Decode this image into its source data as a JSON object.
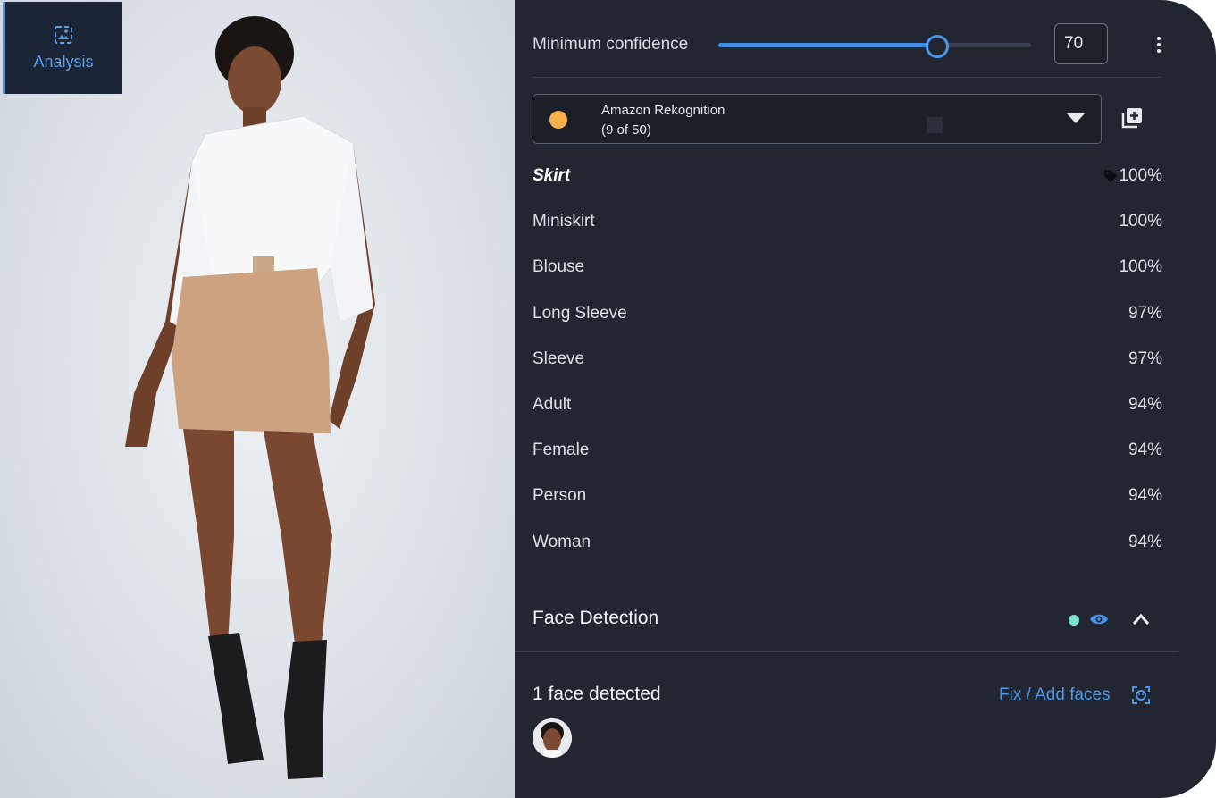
{
  "sidebar": {
    "analysis_tab_label": "Analysis",
    "analysis_tab_icon": "image-analysis-icon"
  },
  "confidence": {
    "label": "Minimum confidence",
    "value": "70",
    "slider_fraction": 0.7
  },
  "engine": {
    "name": "Amazon Rekognition",
    "count": "(9 of 50)",
    "dot_color": "#f7b04a"
  },
  "labels": [
    {
      "name": "Skirt",
      "value": "100%"
    },
    {
      "name": "Miniskirt",
      "value": "100%"
    },
    {
      "name": "Blouse",
      "value": "100%"
    },
    {
      "name": "Long Sleeve",
      "value": "97%"
    },
    {
      "name": "Sleeve",
      "value": "97%"
    },
    {
      "name": "Adult",
      "value": "94%"
    },
    {
      "name": "Female",
      "value": "94%"
    },
    {
      "name": "Person",
      "value": "94%"
    },
    {
      "name": "Woman",
      "value": "94%"
    }
  ],
  "face_detection": {
    "title": "Face Detection",
    "status_color": "#7fe3cf",
    "count_text": "1 face detected",
    "fix_label": "Fix / Add faces"
  },
  "colors": {
    "accent": "#4a96ec",
    "panel_bg": "#212631"
  }
}
